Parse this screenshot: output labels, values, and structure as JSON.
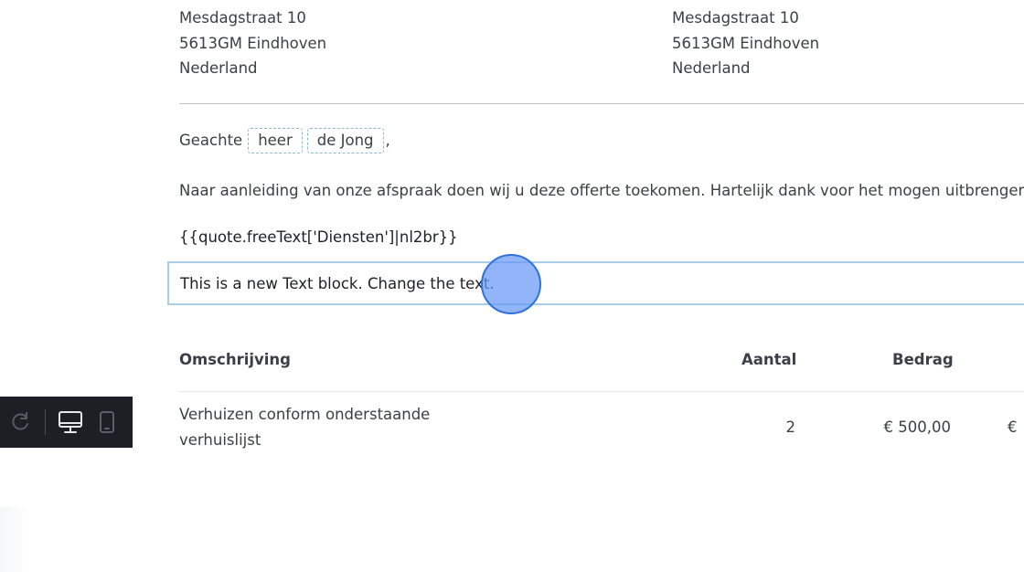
{
  "sender_address": {
    "street": "Mesdagstraat 10",
    "postal_city": "5613GM Eindhoven",
    "country": "Nederland"
  },
  "recipient_address": {
    "street": "Mesdagstraat 10",
    "postal_city": "5613GM Eindhoven",
    "country": "Nederland"
  },
  "greeting": {
    "salutation": "Geachte",
    "title_token": "heer",
    "name_token": "de Jong",
    "punctuation": ","
  },
  "intro_text": "Naar aanleiding van onze afspraak doen wij u deze offerte toekomen. Hartelijk dank voor het mogen uitbrengen",
  "template_variable": "{{quote.freeText['Diensten']|nl2br}}",
  "selected_text_block": "This is a new Text block. Change the text.",
  "table": {
    "headers": {
      "description": "Omschrijving",
      "quantity": "Aantal",
      "amount": "Bedrag"
    },
    "rows": [
      {
        "description": "Verhuizen conform onderstaande verhuislijst",
        "quantity": "2",
        "amount": "€ 500,00",
        "total": "€"
      }
    ]
  },
  "toolbar": {
    "icons": [
      "redo-icon",
      "desktop-view-icon",
      "mobile-view-icon"
    ]
  },
  "colors": {
    "token_border": "#8fb8c8",
    "selection_border": "#a9cde6",
    "cursor_fill": "#6699f5",
    "toolbar_bg": "#1c1f24"
  }
}
